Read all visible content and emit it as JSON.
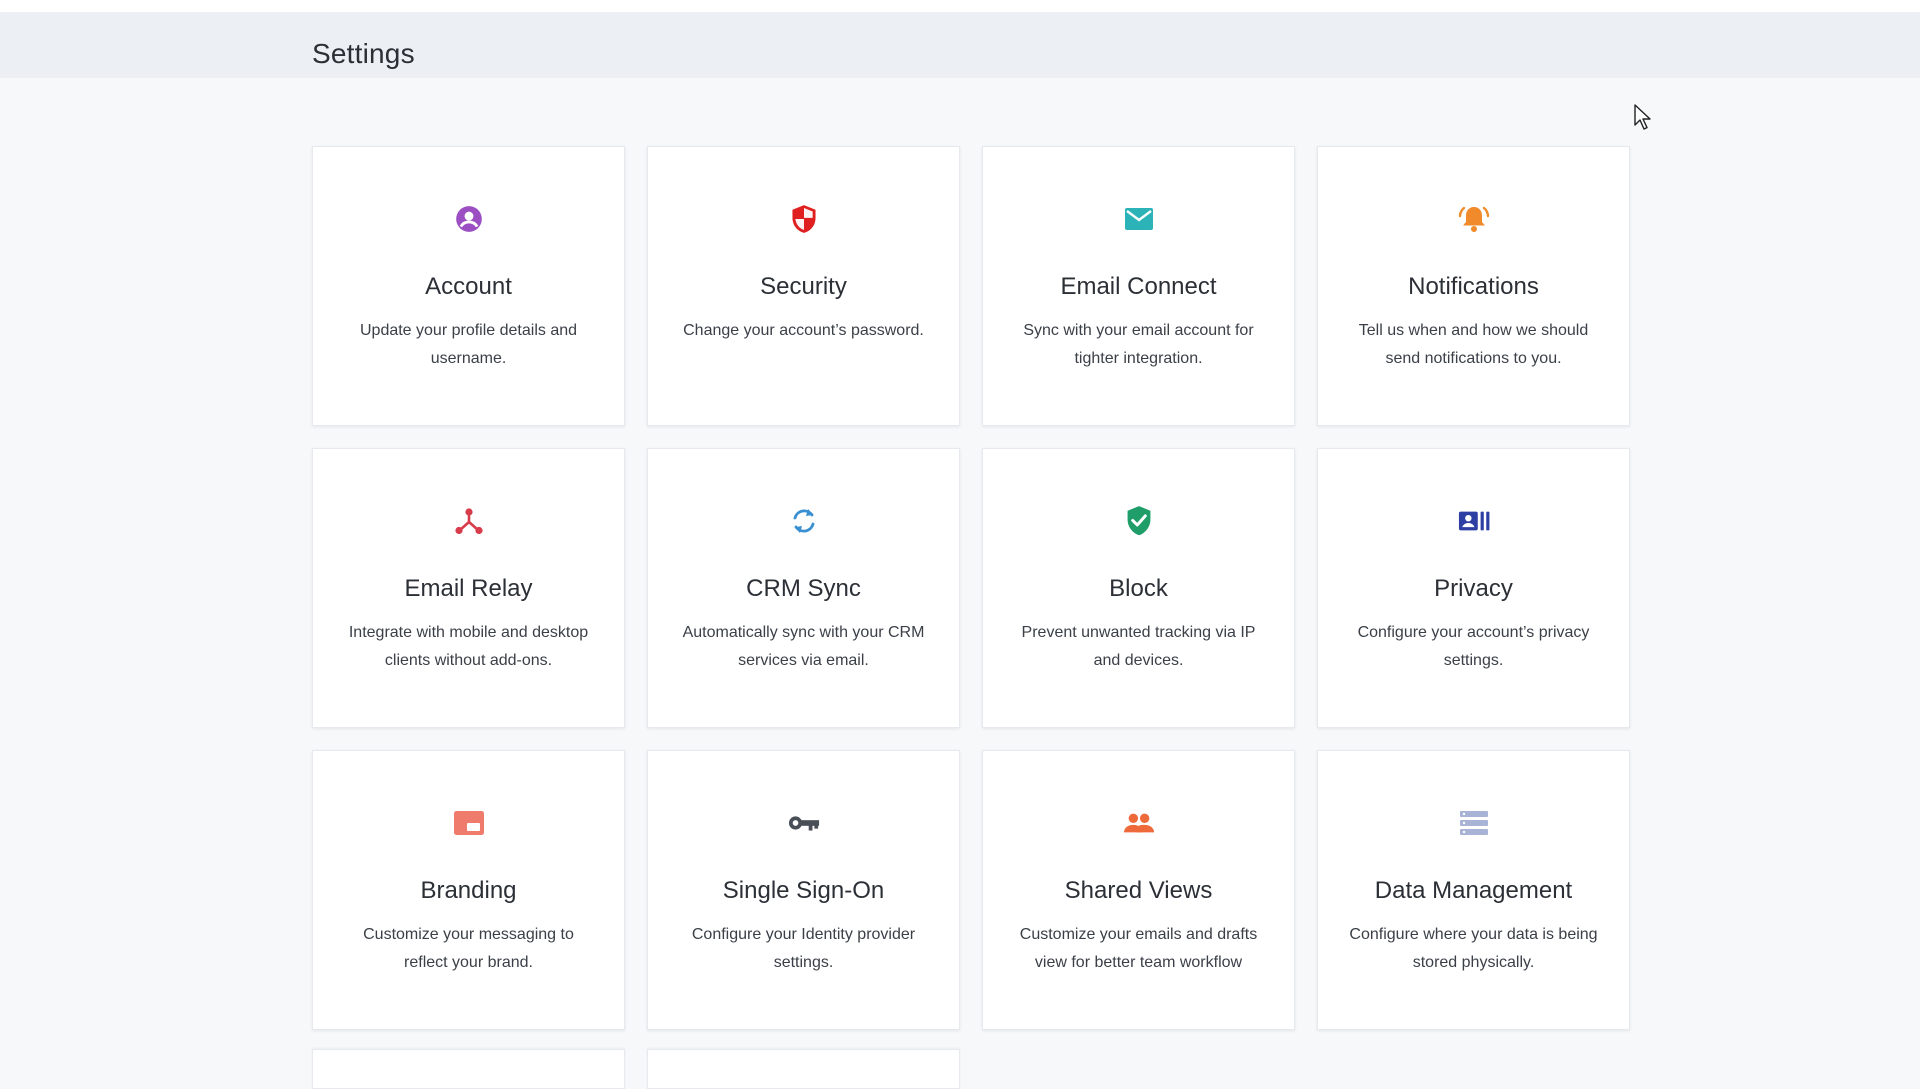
{
  "header": {
    "title": "Settings"
  },
  "cards": [
    {
      "title": "Account",
      "description": "Update your profile details and username.",
      "icon": "account-circle-icon",
      "color": "#9b4fc3"
    },
    {
      "title": "Security",
      "description": "Change your account’s password.",
      "icon": "shield-icon",
      "color": "#e02020"
    },
    {
      "title": "Email Connect",
      "description": "Sync with your email account for tighter integration.",
      "icon": "envelope-icon",
      "color": "#2bb3b8"
    },
    {
      "title": "Notifications",
      "description": "Tell us when and how we should send notifications to you.",
      "icon": "bell-ringing-icon",
      "color": "#f08a2a"
    },
    {
      "title": "Email Relay",
      "description": "Integrate with mobile and desktop clients without add-ons.",
      "icon": "relay-hub-icon",
      "color": "#d83b4a"
    },
    {
      "title": "CRM Sync",
      "description": "Automatically sync with your CRM services via email.",
      "icon": "sync-icon",
      "color": "#3a8fd1"
    },
    {
      "title": "Block",
      "description": "Prevent unwanted tracking via IP and devices.",
      "icon": "shield-check-icon",
      "color": "#1f9e6a"
    },
    {
      "title": "Privacy",
      "description": "Configure your account’s privacy settings.",
      "icon": "id-card-icon",
      "color": "#2e3fa3"
    },
    {
      "title": "Branding",
      "description": "Customize your messaging to reflect your brand.",
      "icon": "branding-card-icon",
      "color": "#ef7b6c"
    },
    {
      "title": "Single Sign-On",
      "description": "Configure your Identity provider settings.",
      "icon": "key-icon",
      "color": "#4a4f57"
    },
    {
      "title": "Shared Views",
      "description": "Customize your emails and drafts view for better team workflow",
      "icon": "people-icon",
      "color": "#ee6a3a"
    },
    {
      "title": "Data Management",
      "description": "Configure where your data is being stored physically.",
      "icon": "storage-icon",
      "color": "#a9b3d6"
    }
  ]
}
